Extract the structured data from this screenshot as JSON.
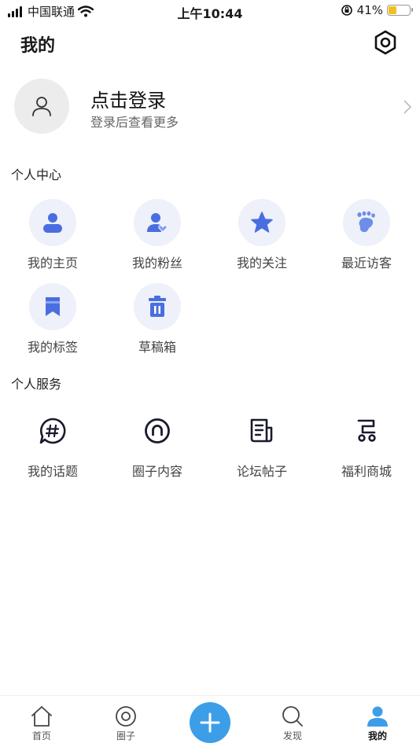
{
  "status_bar": {
    "carrier": "中国联通",
    "time": "上午10:44",
    "battery_text": "41%",
    "battery_level": 0.41,
    "battery_color": "#f2c01d"
  },
  "header": {
    "title": "我的",
    "settings_icon": "settings-hexagon-icon"
  },
  "profile": {
    "title": "点击登录",
    "subtitle": "登录后查看更多",
    "avatar_icon": "user-outline-icon"
  },
  "personal_center": {
    "title": "个人中心",
    "items": [
      {
        "label": "我的主页",
        "icon": "user-icon"
      },
      {
        "label": "我的粉丝",
        "icon": "user-heart-icon"
      },
      {
        "label": "我的关注",
        "icon": "star-icon"
      },
      {
        "label": "最近访客",
        "icon": "footprint-icon"
      },
      {
        "label": "我的标签",
        "icon": "bookmark-icon"
      },
      {
        "label": "草稿箱",
        "icon": "trash-icon"
      }
    ]
  },
  "personal_services": {
    "title": "个人服务",
    "items": [
      {
        "label": "我的话题",
        "icon": "hashtag-bubble-icon"
      },
      {
        "label": "圈子内容",
        "icon": "circle-icon"
      },
      {
        "label": "论坛帖子",
        "icon": "newspaper-icon"
      },
      {
        "label": "福利商城",
        "icon": "cart-icon"
      }
    ]
  },
  "tabbar": {
    "tabs": [
      {
        "label": "首页",
        "icon": "home-icon",
        "active": false
      },
      {
        "label": "圈子",
        "icon": "circle-tab-icon",
        "active": false
      },
      {
        "label": "",
        "icon": "plus-icon",
        "active": false
      },
      {
        "label": "发现",
        "icon": "search-icon",
        "active": false
      },
      {
        "label": "我的",
        "icon": "profile-icon",
        "active": true
      }
    ]
  },
  "colors": {
    "accent_icon": "#4a6ee0",
    "icon_bg": "#eef0fa",
    "fab": "#3d9ee8",
    "active_tab": "#3d9ee8"
  }
}
